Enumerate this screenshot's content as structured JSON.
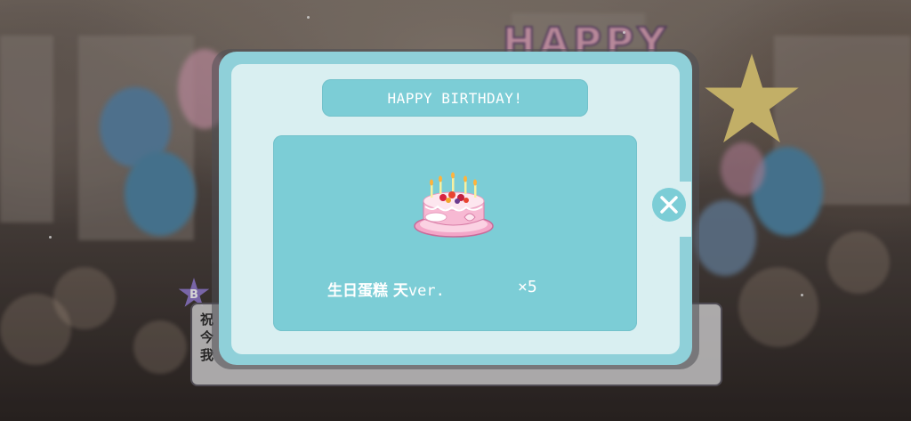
{
  "background": {
    "sign_text": "HAPPY",
    "dialogue_lines": [
      "祝",
      "今",
      "我"
    ],
    "character_badge": "B"
  },
  "reward_popup": {
    "title": "HAPPY BIRTHDAY!",
    "item": {
      "name": "生日蛋糕 天",
      "name_suffix": "ver.",
      "count": "×5",
      "icon": "birthday-cake-icon"
    },
    "close_icon": "close-icon"
  },
  "colors": {
    "panel_teal": "#7ccdd6",
    "frame_teal": "#8fd0d9",
    "inner_light": "#d9eff1",
    "text_white": "#ffffff"
  }
}
